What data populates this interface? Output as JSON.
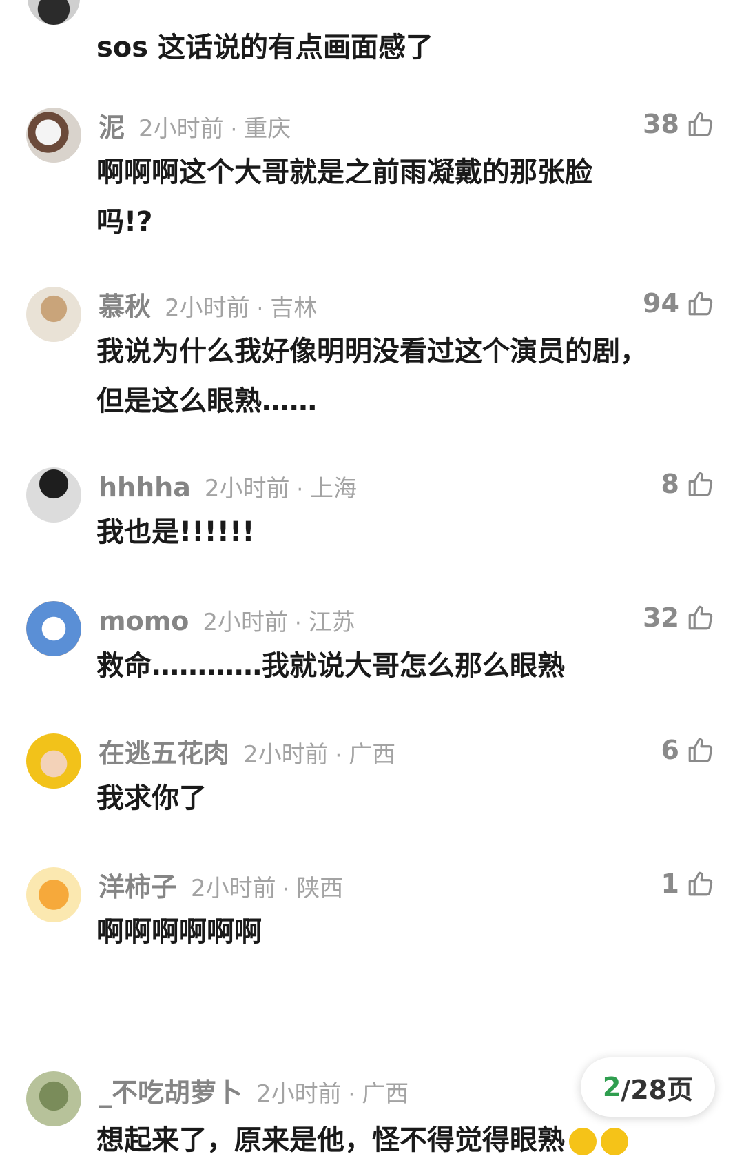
{
  "top_comment": {
    "text": "sos 这话说的有点画面感了"
  },
  "comments": [
    {
      "username": "泥",
      "time": "2小时前",
      "location": "重庆",
      "likes": "38",
      "lines": [
        "啊啊啊这个大哥就是之前雨凝戴的那张脸",
        "吗!?"
      ],
      "avatar": "cat-avatar"
    },
    {
      "username": "慕秋",
      "time": "2小时前",
      "location": "吉林",
      "likes": "94",
      "lines": [
        "我说为什么我好像明明没看过这个演员的剧，",
        "但是这么眼熟……"
      ],
      "avatar": "dog-avatar"
    },
    {
      "username": "hhhha",
      "time": "2小时前",
      "location": "上海",
      "likes": "8",
      "lines": [
        "我也是!!!!!!"
      ],
      "avatar": "sunglasses-avatar"
    },
    {
      "username": "momo",
      "time": "2小时前",
      "location": "江苏",
      "likes": "32",
      "lines": [
        "救命…………我就说大哥怎么那么眼熟"
      ],
      "avatar": "dog-sunglasses-avatar"
    },
    {
      "username": "在逃五花肉",
      "time": "2小时前",
      "location": "广西",
      "likes": "6",
      "lines": [
        "我求你了"
      ],
      "avatar": "child-yellow-hat-avatar"
    },
    {
      "username": "洋柿子",
      "time": "2小时前",
      "location": "陕西",
      "likes": "1",
      "lines": [
        "啊啊啊啊啊啊"
      ],
      "avatar": "cartoon-dog-avatar"
    },
    {
      "username": "_不吃胡萝卜",
      "time": "2小时前",
      "location": "广西",
      "likes": "",
      "lines": [
        "想起来了，原来是他，怪不得觉得眼熟"
      ],
      "avatar": "frog-avatar"
    }
  ],
  "separator": "·",
  "pager": {
    "current": "2",
    "text": "/28页"
  },
  "colors": {
    "accent_green": "#2f9e4f",
    "meta_gray": "#a3a3a3",
    "text_dark": "#1a1a1a"
  }
}
